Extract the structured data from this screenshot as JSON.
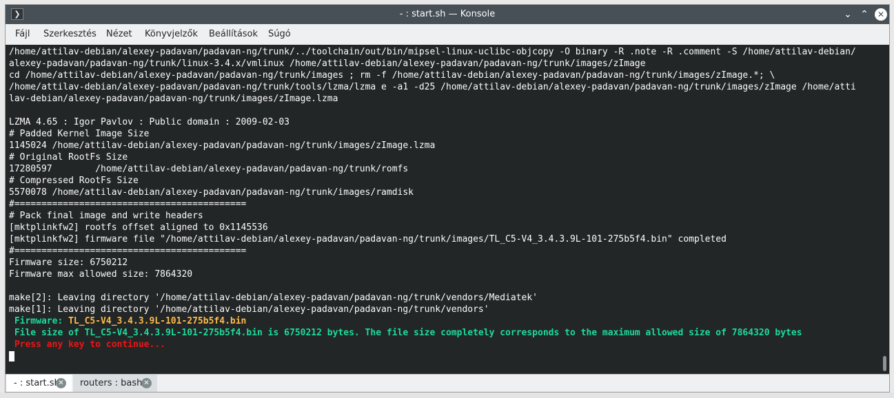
{
  "window": {
    "title": "- : start.sh — Konsole",
    "app_icon_glyph": "❯",
    "controls": {
      "minimize": "⌄",
      "maximize": "⌃",
      "close": "✕"
    }
  },
  "menubar": {
    "items": [
      {
        "label": "Fájl"
      },
      {
        "label": "Szerkesztés"
      },
      {
        "label": "Nézet"
      },
      {
        "label": "Könyvjelzők"
      },
      {
        "label": "Beállítások"
      },
      {
        "label": "Súgó"
      }
    ]
  },
  "terminal": {
    "colors": {
      "background": "#232627",
      "foreground": "#fcfcfc",
      "label_green": "#1cdc9a",
      "value_yellow": "#fdbc4b",
      "error_red": "#ed1515"
    },
    "lines": [
      "/home/attilav-debian/alexey-padavan/padavan-ng/trunk/../toolchain/out/bin/mipsel-linux-uclibc-objcopy -O binary -R .note -R .comment -S /home/attilav-debian/",
      "alexey-padavan/padavan-ng/trunk/linux-3.4.x/vmlinux /home/attilav-debian/alexey-padavan/padavan-ng/trunk/images/zImage",
      "cd /home/attilav-debian/alexey-padavan/padavan-ng/trunk/images ; rm -f /home/attilav-debian/alexey-padavan/padavan-ng/trunk/images/zImage.*; \\",
      "/home/attilav-debian/alexey-padavan/padavan-ng/trunk/tools/lzma/lzma e -a1 -d25 /home/attilav-debian/alexey-padavan/padavan-ng/trunk/images/zImage /home/atti",
      "lav-debian/alexey-padavan/padavan-ng/trunk/images/zImage.lzma",
      "",
      "LZMA 4.65 : Igor Pavlov : Public domain : 2009-02-03",
      "# Padded Kernel Image Size",
      "1145024 /home/attilav-debian/alexey-padavan/padavan-ng/trunk/images/zImage.lzma",
      "# Original RootFs Size",
      "17280597        /home/attilav-debian/alexey-padavan/padavan-ng/trunk/romfs",
      "# Compressed RootFs Size",
      "5570078 /home/attilav-debian/alexey-padavan/padavan-ng/trunk/images/ramdisk",
      "#===========================================",
      "# Pack final image and write headers",
      "[mktplinkfw2] rootfs offset aligned to 0x1145536",
      "[mktplinkfw2] firmware file \"/home/attilav-debian/alexey-padavan/padavan-ng/trunk/images/TL_C5-V4_3.4.3.9L-101-275b5f4.bin\" completed",
      "#===========================================",
      "Firmware size: 6750212",
      "Firmware max allowed size: 7864320",
      "",
      "make[2]: Leaving directory '/home/attilav-debian/alexey-padavan/padavan-ng/trunk/vendors/Mediatek'",
      "make[1]: Leaving directory '/home/attilav-debian/alexey-padavan/padavan-ng/trunk/vendors'"
    ],
    "firmware_label": " Firmware: ",
    "firmware_value": "TL_C5-V4_3.4.3.9L-101-275b5f4.bin",
    "size_message": " File size of TL_C5-V4_3.4.3.9L-101-275b5f4.bin is 6750212 bytes. The file size completely corresponds to the maximum allowed size of 7864320 bytes",
    "press_key": " Press any key to continue..."
  },
  "tabs": [
    {
      "label": "- : start.sh",
      "close_glyph": "✕",
      "active": true
    },
    {
      "label": "routers : bash",
      "close_glyph": "✕",
      "active": false
    }
  ]
}
